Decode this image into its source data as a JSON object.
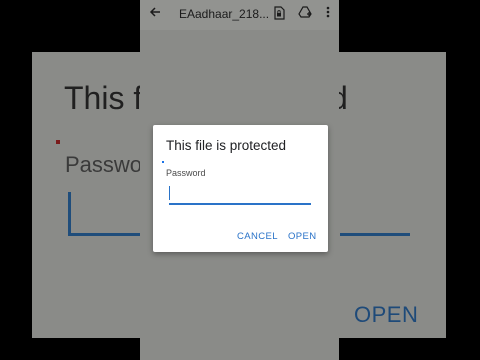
{
  "appbar": {
    "title": "EAadhaar_218...",
    "back_icon": "back-arrow-icon",
    "icons": [
      "file-lock-icon",
      "drive-add-icon",
      "more-vert-icon"
    ]
  },
  "background_dialog": {
    "title_left": "This fi",
    "title_right": "d",
    "password_label": "Passwo",
    "open_label": "OPEN"
  },
  "dialog": {
    "title": "This file is protected",
    "password_label": "Password",
    "password_value": "",
    "cancel_label": "CANCEL",
    "open_label": "OPEN"
  },
  "colors": {
    "accent": "#2a73c8",
    "scrim": "#8a8b88"
  }
}
